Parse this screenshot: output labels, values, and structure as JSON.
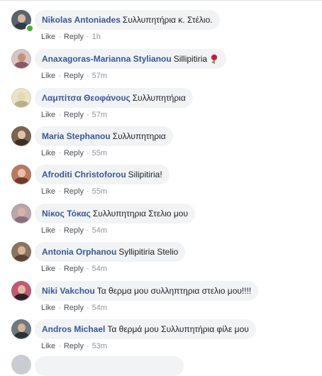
{
  "actions": {
    "like_label": "Like",
    "reply_label": "Reply",
    "separator": "·"
  },
  "comments": [
    {
      "author": "Nikolas Antoniades",
      "text": "Συλλυπητήρια κ. Στέλιο.",
      "time": "1h",
      "online": true,
      "avatar_colors": {
        "bg": "#5a6470",
        "face": "#d9b89a",
        "body": "#2f3b48"
      }
    },
    {
      "author": "Anaxagoras-Marianna Stylianou",
      "text": "Sillipitiria",
      "emoji": "rose-emoji",
      "time": "57m",
      "online": false,
      "avatar_colors": {
        "bg": "#d7c6c6",
        "face": "#c98e7c",
        "body": "#8a5a63"
      }
    },
    {
      "author": "Λαμπίτσα Θεοφάνους",
      "text": "Συλλυπητήρια",
      "time": "57m",
      "online": false,
      "avatar_colors": {
        "bg": "#e9e4c8",
        "face": "#e6d9b0",
        "body": "#b7b08a"
      }
    },
    {
      "author": "Maria Stephanou",
      "text": "Συλλυπητηρια",
      "time": "55m",
      "online": false,
      "avatar_colors": {
        "bg": "#7a6452",
        "face": "#e2c2a2",
        "body": "#3b2e27"
      }
    },
    {
      "author": "Afroditi Christoforou",
      "text": "Silipitiria!",
      "time": "55m",
      "online": false,
      "avatar_colors": {
        "bg": "#b87a62",
        "face": "#e8c0a8",
        "body": "#6e3a2c"
      }
    },
    {
      "author": "Νίκος Τόκας",
      "text": "Συλλυπητηρια Στελιο μου",
      "time": "54m",
      "online": false,
      "avatar_colors": {
        "bg": "#b9a6ae",
        "face": "#d9b4a4",
        "body": "#8c6f7d"
      }
    },
    {
      "author": "Antonia Orphanou",
      "text": "Syllipitiria Stelio",
      "time": "54m",
      "online": false,
      "avatar_colors": {
        "bg": "#8c7560",
        "face": "#d8b396",
        "body": "#5a4433"
      }
    },
    {
      "author": "Niki Vakchou",
      "text": "Τα θερμα μου συλληπτηρια στελιο μου!!!!",
      "time": "54m",
      "online": false,
      "avatar_colors": {
        "bg": "#c05a72",
        "face": "#e2b8a4",
        "body": "#2a2226"
      }
    },
    {
      "author": "Andros Michael",
      "text": "Τα θερμά μου Συλλυπητήρια φίλε μου",
      "time": "53m",
      "online": false,
      "avatar_colors": {
        "bg": "#6f7a80",
        "face": "#d7b294",
        "body": "#2c3236"
      }
    }
  ],
  "colors": {
    "author_link": "#385898",
    "bubble_bg": "#f2f3f5",
    "meta_text": "#606770",
    "online": "#42b72a"
  }
}
